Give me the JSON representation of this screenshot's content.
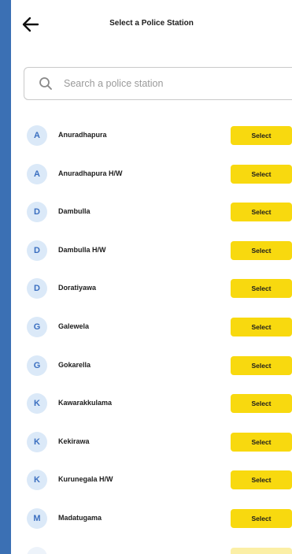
{
  "header": {
    "title": "Select a Police Station"
  },
  "search": {
    "placeholder": "Search a police station",
    "value": ""
  },
  "select_label": "Select",
  "stations": [
    {
      "initial": "A",
      "name": "Anuradhapura"
    },
    {
      "initial": "A",
      "name": "Anuradhapura H/W"
    },
    {
      "initial": "D",
      "name": "Dambulla"
    },
    {
      "initial": "D",
      "name": "Dambulla H/W"
    },
    {
      "initial": "D",
      "name": "Doratiyawa"
    },
    {
      "initial": "G",
      "name": "Galewela"
    },
    {
      "initial": "G",
      "name": "Gokarella"
    },
    {
      "initial": "K",
      "name": "Kawarakkulama"
    },
    {
      "initial": "K",
      "name": "Kekirawa"
    },
    {
      "initial": "K",
      "name": "Kurunegala H/W"
    },
    {
      "initial": "M",
      "name": "Madatugama"
    }
  ],
  "colors": {
    "frame": "#3b70b4",
    "accent_yellow": "#f8d90f",
    "avatar_bg": "#dbe9f8",
    "avatar_text": "#3b6fc0"
  },
  "icons": {
    "back": "arrow-left-icon",
    "search": "search-icon"
  }
}
